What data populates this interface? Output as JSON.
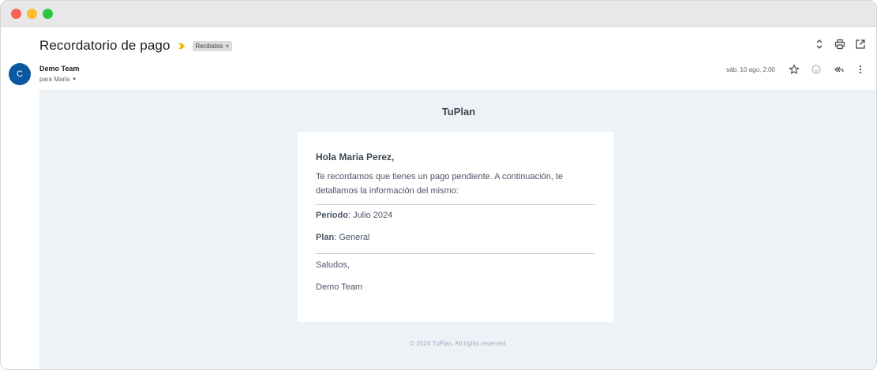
{
  "window": {
    "controls": [
      "close",
      "minimize",
      "maximize"
    ]
  },
  "message": {
    "subject": "Recordatorio de pago",
    "importance_icon": "importance-marker-icon",
    "label": {
      "name": "Recibidos",
      "remove": "×"
    },
    "sender": {
      "avatar_initial": "C",
      "name": "Demo Team",
      "recipient_text": "para Maria"
    },
    "date": "sáb, 10 ago, 2:00"
  },
  "colors": {
    "avatar": "#0b57a0",
    "importance": "#f4b400",
    "email_bg": "#edf2f7",
    "text": "#4a5568"
  },
  "email": {
    "brand": "TuPlan",
    "greeting": "Hola Maria Perez,",
    "intro": "Te recordamos que tienes un pago pendiente. A continuación, te detallamos la información del mismo:",
    "period_label": "Período",
    "period_value": ": Julio 2024",
    "plan_label": "Plan",
    "plan_value": ": General",
    "closing": "Saludos,",
    "signature": "Demo Team",
    "footer": "© 2024 TuPlan. All rights reserved."
  }
}
